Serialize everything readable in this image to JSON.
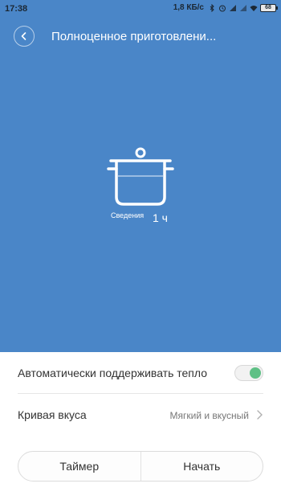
{
  "status_bar": {
    "time": "17:38",
    "network_speed": "1,8 КБ/с",
    "battery": "68",
    "icons": [
      "bluetooth-icon",
      "alarm-icon",
      "signal-icon",
      "signal-icon",
      "wifi-icon",
      "battery-icon"
    ]
  },
  "header": {
    "title": "Полноценное приготовлени..."
  },
  "cooking": {
    "stage": "Сведения",
    "duration": "1 ч"
  },
  "settings": {
    "keep_warm_label": "Автоматически поддерживать тепло",
    "keep_warm_on": true,
    "taste_curve_label": "Кривая вкуса",
    "taste_curve_value": "Мягкий и вкусный"
  },
  "actions": {
    "timer_label": "Таймер",
    "start_label": "Начать"
  },
  "colors": {
    "hero_background": "#4a86c8",
    "toggle_on": "#5ec085"
  }
}
